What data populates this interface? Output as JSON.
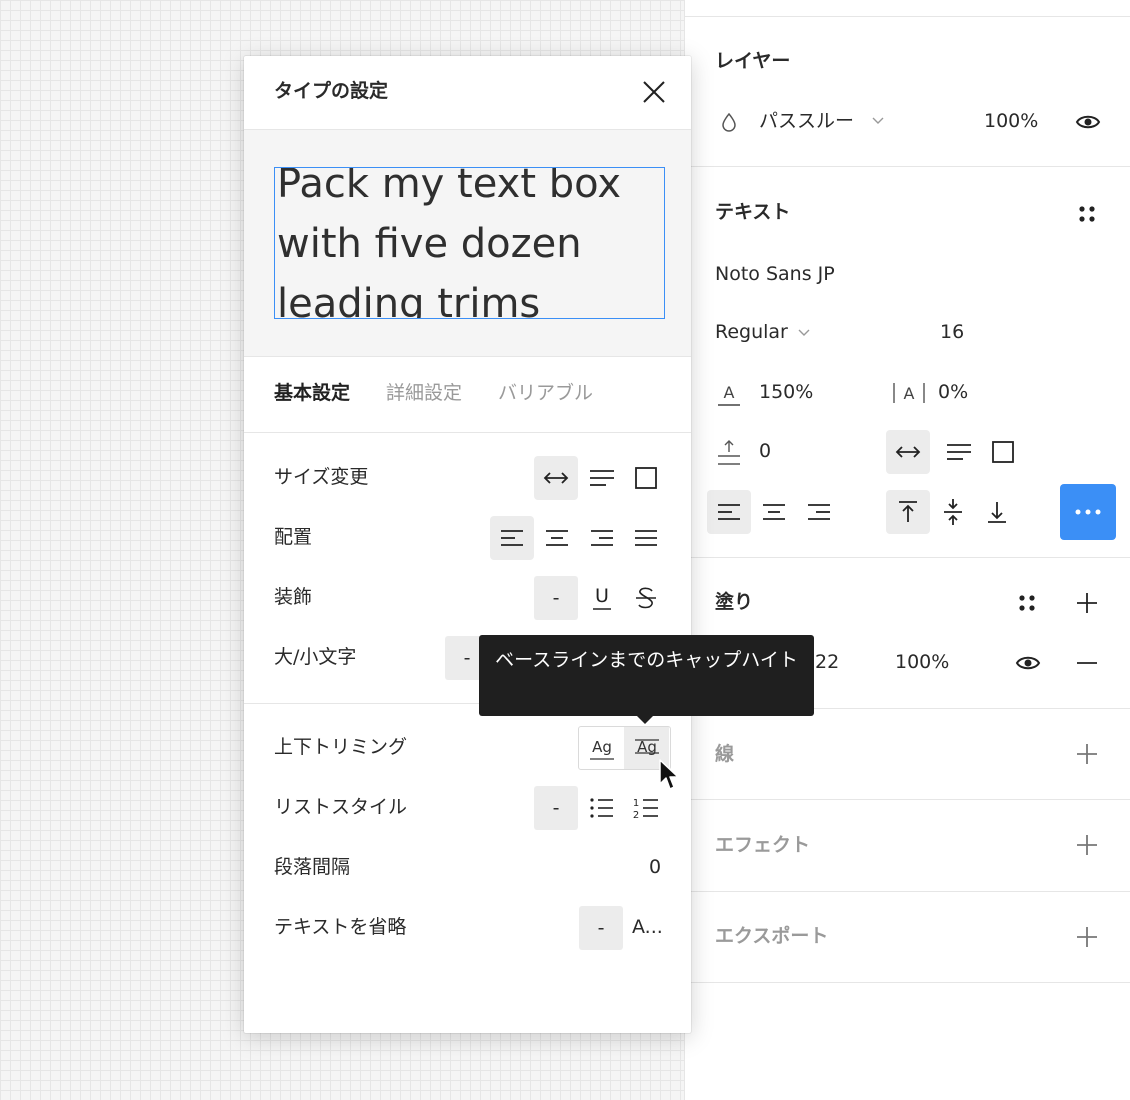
{
  "panel": {
    "layer": {
      "title": "レイヤー",
      "blend_mode": "パススルー",
      "opacity": "100%"
    },
    "text": {
      "title": "テキスト",
      "font_family": "Noto Sans JP",
      "font_weight": "Regular",
      "font_size": "16",
      "line_height": "150%",
      "letter_spacing": "0%",
      "paragraph_spacing": "0"
    },
    "fill": {
      "title": "塗り",
      "hex_partial": "22",
      "opacity": "100%"
    },
    "stroke": {
      "title": "線"
    },
    "effect": {
      "title": "エフェクト"
    },
    "export": {
      "title": "エクスポート"
    }
  },
  "dialog": {
    "title": "タイプの設定",
    "preview_text": "Pack my text box\nwith five dozen\nleading trims",
    "tabs": [
      "基本設定",
      "詳細設定",
      "バリアブル"
    ],
    "rows": {
      "resize": "サイズ変更",
      "align": "配置",
      "decoration": "装飾",
      "case": "大/小文字",
      "vertical_trim": "上下トリミング",
      "list_style": "リストスタイル",
      "paragraph_spacing": "段落間隔",
      "truncate": "テキストを省略"
    },
    "dash": "-",
    "paragraph_spacing_value": "0",
    "truncate_option": "A...",
    "underline_glyph": "U",
    "trim_icon_text": "Ag",
    "list_numbers": [
      "1",
      "2"
    ]
  },
  "tooltip": {
    "text": "ベースラインまでのキャップハイト"
  },
  "colors": {
    "accent": "#3b8ff6",
    "tooltip_bg": "#1f1f1f",
    "pressed_bg": "#ececec"
  }
}
